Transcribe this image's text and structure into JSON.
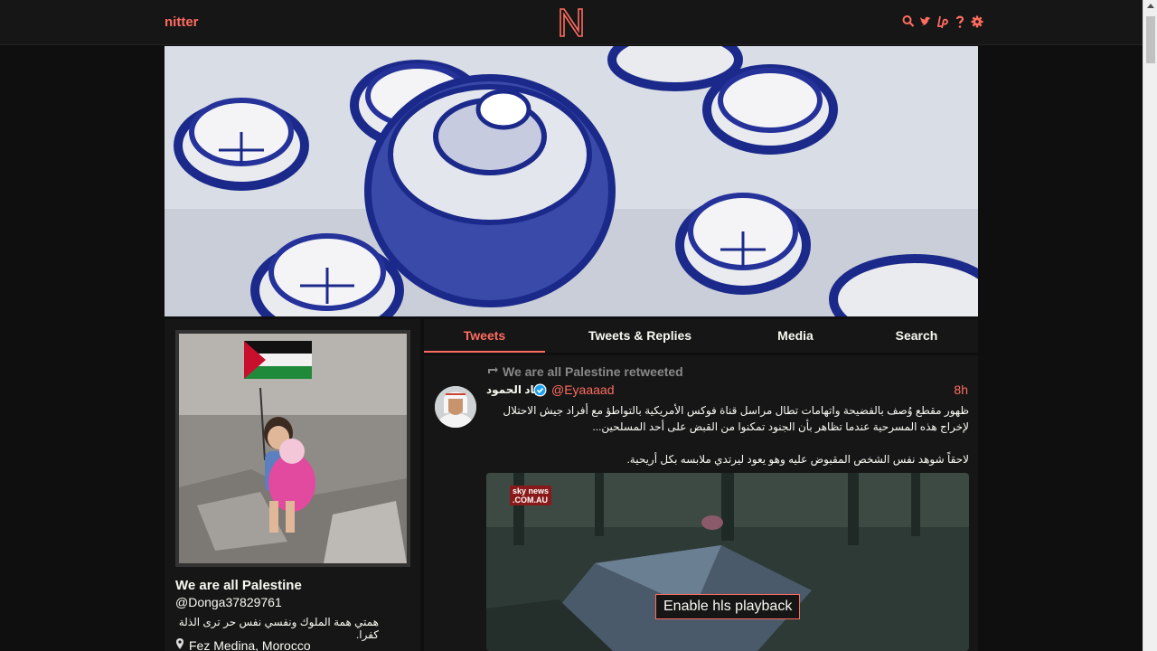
{
  "navbar": {
    "brand": "nitter",
    "icons": [
      "search-icon",
      "twitter-icon",
      "liberapay-icon",
      "help-icon",
      "gear-icon"
    ]
  },
  "profile": {
    "fullname": "We are all Palestine",
    "username": "@Donga37829761",
    "bio": "همتي همة الملوك ونفسي نفس حر ترى الذلة كفرا.",
    "location": "Fez Medina, Morocco"
  },
  "tabs": [
    {
      "label": "Tweets",
      "active": true
    },
    {
      "label": "Tweets & Replies",
      "active": false
    },
    {
      "label": "Media",
      "active": false
    },
    {
      "label": "Search",
      "active": false
    }
  ],
  "tweet": {
    "retweet_header": "We are all Palestine retweeted",
    "fullname": "إياد الحمود",
    "verified": true,
    "username": "@Eyaaaad",
    "date": "8h",
    "text_lines": [
      "ظهور مقطع وُصف بالفضيحة واتهامات تطال مراسل قناة فوكس الأمريكية بالتواطؤ مع أفراد جيش الاحتلال لإخراج هذه المسرحية عندما تظاهر بأن الجنود تمكنوا من القبض على أحد المسلحين...",
      "",
      "لاحقاً شوهد نفس الشخص المقبوض عليه وهو يعود ليرتدي ملابسه بكل أريحية."
    ],
    "video_watermark": "sky news",
    "video_watermark_sub": ".COM.AU",
    "video_button": "Enable hls playback"
  },
  "colors": {
    "accent": "#ff6c60",
    "bg": "#0f0f0f",
    "panel": "#161616"
  }
}
